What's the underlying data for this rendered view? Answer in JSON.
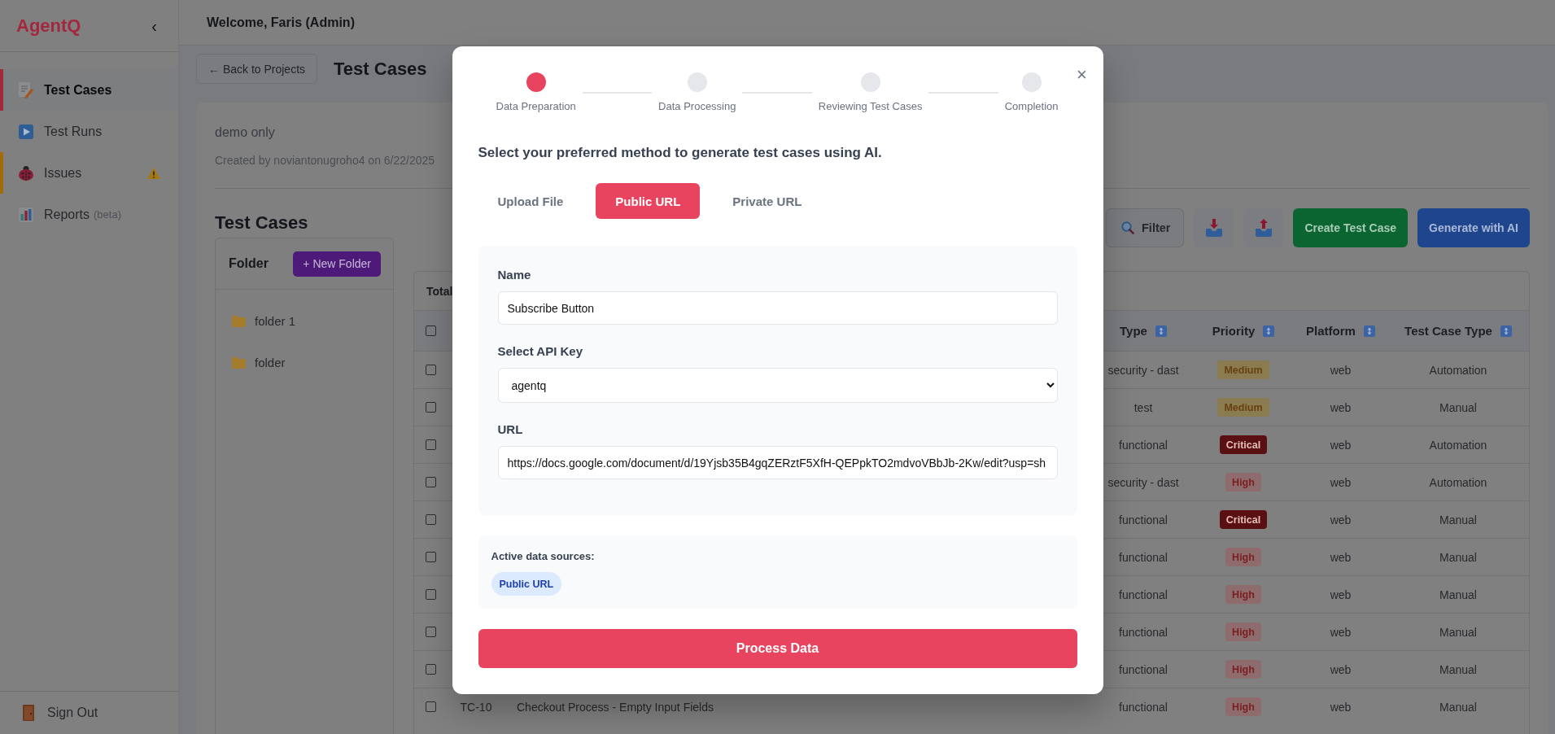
{
  "sidebar": {
    "logo": "AgentQ",
    "collapse": "‹",
    "items": [
      {
        "label": "Test Cases",
        "selected": true,
        "alert": false
      },
      {
        "label": "Test Runs",
        "selected": false,
        "alert": false
      },
      {
        "label": "Issues",
        "selected": false,
        "alert": true
      },
      {
        "label": "Reports",
        "note": "(beta)",
        "selected": false,
        "alert": false
      }
    ],
    "sign_out": "Sign Out"
  },
  "header": {
    "welcome": "Welcome, Faris (Admin)"
  },
  "page": {
    "back_button": "← Back to Projects",
    "title": "Test Cases"
  },
  "project": {
    "name": "demo only",
    "created": "Created by noviantonugroho4 on 6/22/2025"
  },
  "test_cases": {
    "title": "Test Cases",
    "folders": {
      "title": "Folder",
      "new_button": "+ New Folder",
      "items": [
        {
          "name": "folder 1"
        },
        {
          "name": "folder"
        }
      ]
    },
    "toolbar": {
      "filter": "Filter",
      "create": "Create Test Case",
      "generate": "Generate with AI"
    },
    "table": {
      "total": "Total",
      "header_checked": false,
      "columns": [
        "Type",
        "Priority",
        "Platform",
        "Test Case Type"
      ],
      "rows": [
        {
          "checked": false,
          "type": "security - dast",
          "priority": {
            "text": "Medium",
            "kind": "medium"
          },
          "platform": "web",
          "case_type": "Automation"
        },
        {
          "checked": false,
          "type": "test",
          "priority": {
            "text": "Medium",
            "kind": "medium"
          },
          "platform": "web",
          "case_type": "Manual"
        },
        {
          "checked": false,
          "type": "functional",
          "priority": {
            "text": "Critical",
            "kind": "critical"
          },
          "platform": "web",
          "case_type": "Automation"
        },
        {
          "checked": false,
          "type": "security - dast",
          "priority": {
            "text": "High",
            "kind": "high"
          },
          "platform": "web",
          "case_type": "Automation"
        },
        {
          "checked": false,
          "type": "functional",
          "priority": {
            "text": "Critical",
            "kind": "critical"
          },
          "platform": "web",
          "case_type": "Manual"
        },
        {
          "checked": false,
          "type": "functional",
          "priority": {
            "text": "High",
            "kind": "high"
          },
          "platform": "web",
          "case_type": "Manual"
        },
        {
          "checked": false,
          "type": "functional",
          "priority": {
            "text": "High",
            "kind": "high"
          },
          "platform": "web",
          "case_type": "Manual"
        },
        {
          "checked": false,
          "type": "functional",
          "priority": {
            "text": "High",
            "kind": "high"
          },
          "platform": "web",
          "case_type": "Manual"
        },
        {
          "checked": false,
          "type": "functional",
          "priority": {
            "text": "High",
            "kind": "high"
          },
          "platform": "web",
          "case_type": "Manual"
        },
        {
          "checked": false,
          "id": "TC-10",
          "title": "Checkout Process - Empty Input Fields",
          "type": "functional",
          "priority": {
            "text": "High",
            "kind": "high"
          },
          "platform": "web",
          "case_type": "Manual"
        }
      ]
    }
  },
  "modal": {
    "close": "×",
    "steps": [
      {
        "label": "Data Preparation",
        "active": true
      },
      {
        "label": "Data Processing",
        "active": false
      },
      {
        "label": "Reviewing Test Cases",
        "active": false
      },
      {
        "label": "Completion",
        "active": false
      }
    ],
    "prompt": "Select your preferred method to generate test cases using AI.",
    "tabs": [
      {
        "label": "Upload File",
        "selected": false
      },
      {
        "label": "Public URL",
        "selected": true
      },
      {
        "label": "Private URL",
        "selected": false
      }
    ],
    "form": {
      "fields": [
        {
          "kind": "text",
          "label": "Name",
          "value": "Subscribe Button"
        },
        {
          "kind": "select",
          "label": "Select API Key",
          "value": "agentq"
        },
        {
          "kind": "text",
          "label": "URL",
          "value": "https://docs.google.com/document/d/19Yjsb35B4gqZERztF5XfH-QEPpkTO2mdvoVBbJb-2Kw/edit?usp=sh"
        }
      ]
    },
    "sources": {
      "title": "Active data sources:",
      "chips": [
        "Public URL"
      ]
    },
    "submit": "Process Data"
  }
}
